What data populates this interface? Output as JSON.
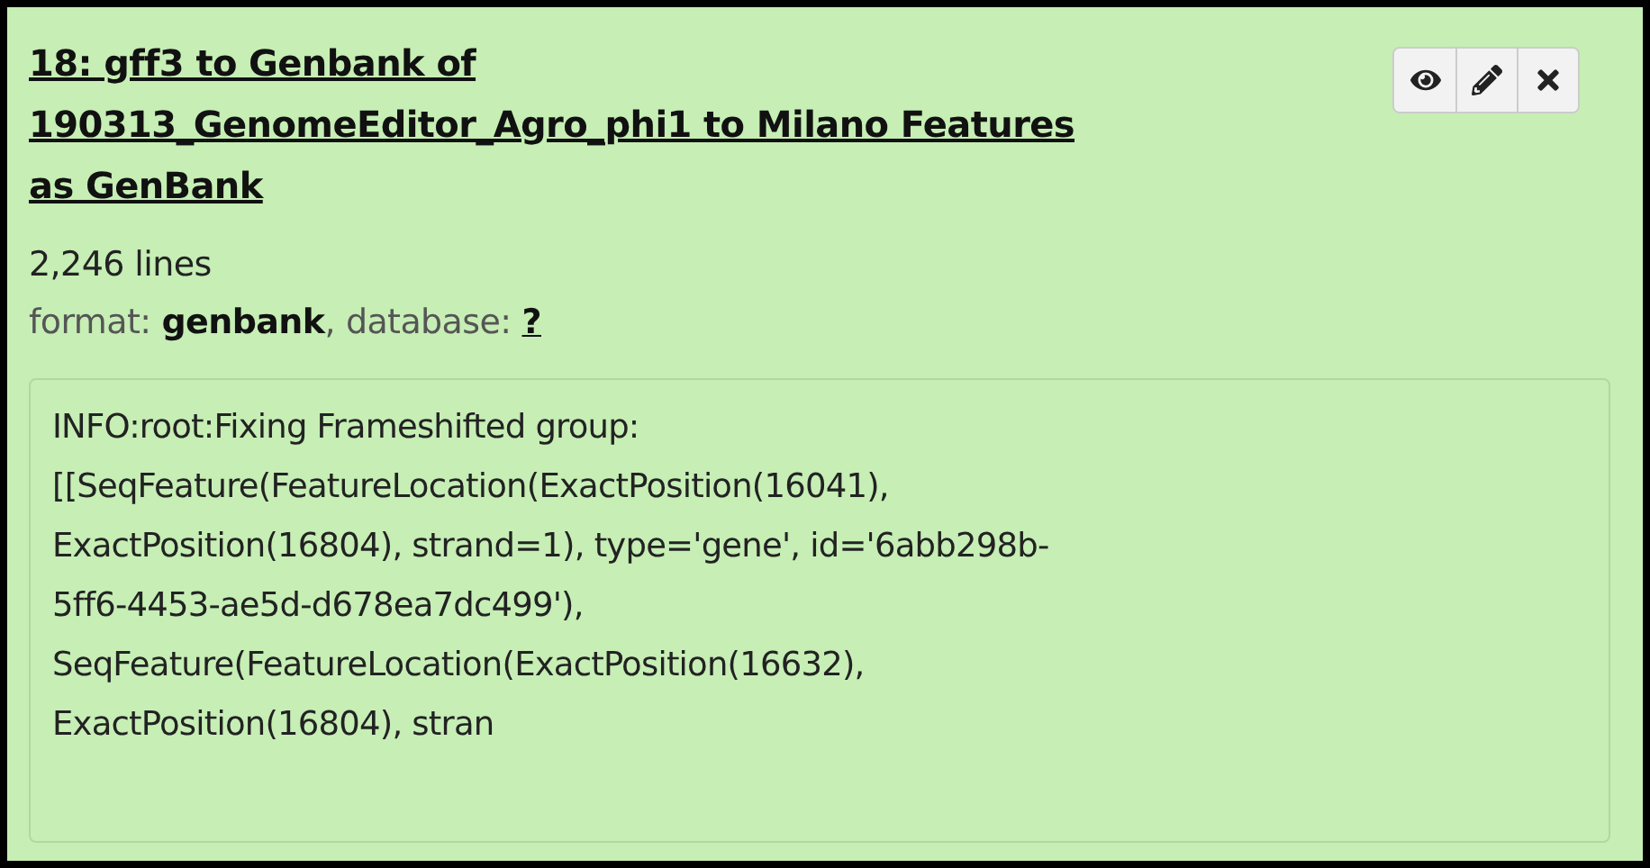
{
  "dataset": {
    "title_lines": [
      "18: gff3 to Genbank of",
      "190313_GenomeEditor_Agro_phi1 to Milano Features",
      "as GenBank"
    ],
    "actions": [
      {
        "kind": "view"
      },
      {
        "kind": "edit"
      },
      {
        "kind": "delete"
      }
    ],
    "lines": "2,246 lines",
    "format_label": "format:",
    "format": "genbank",
    "separator": ",",
    "database_label": "database:",
    "database": "?",
    "peek_lines": [
      "INFO:root:Fixing Frameshifted group:",
      "[[SeqFeature(FeatureLocation(ExactPosition(16041),",
      "ExactPosition(16804), strand=1), type='gene', id='6abb298b-",
      "5ff6-4453-ae5d-d678ea7dc499'),",
      "SeqFeature(FeatureLocation(ExactPosition(16632),",
      "ExactPosition(16804), stran"
    ]
  }
}
